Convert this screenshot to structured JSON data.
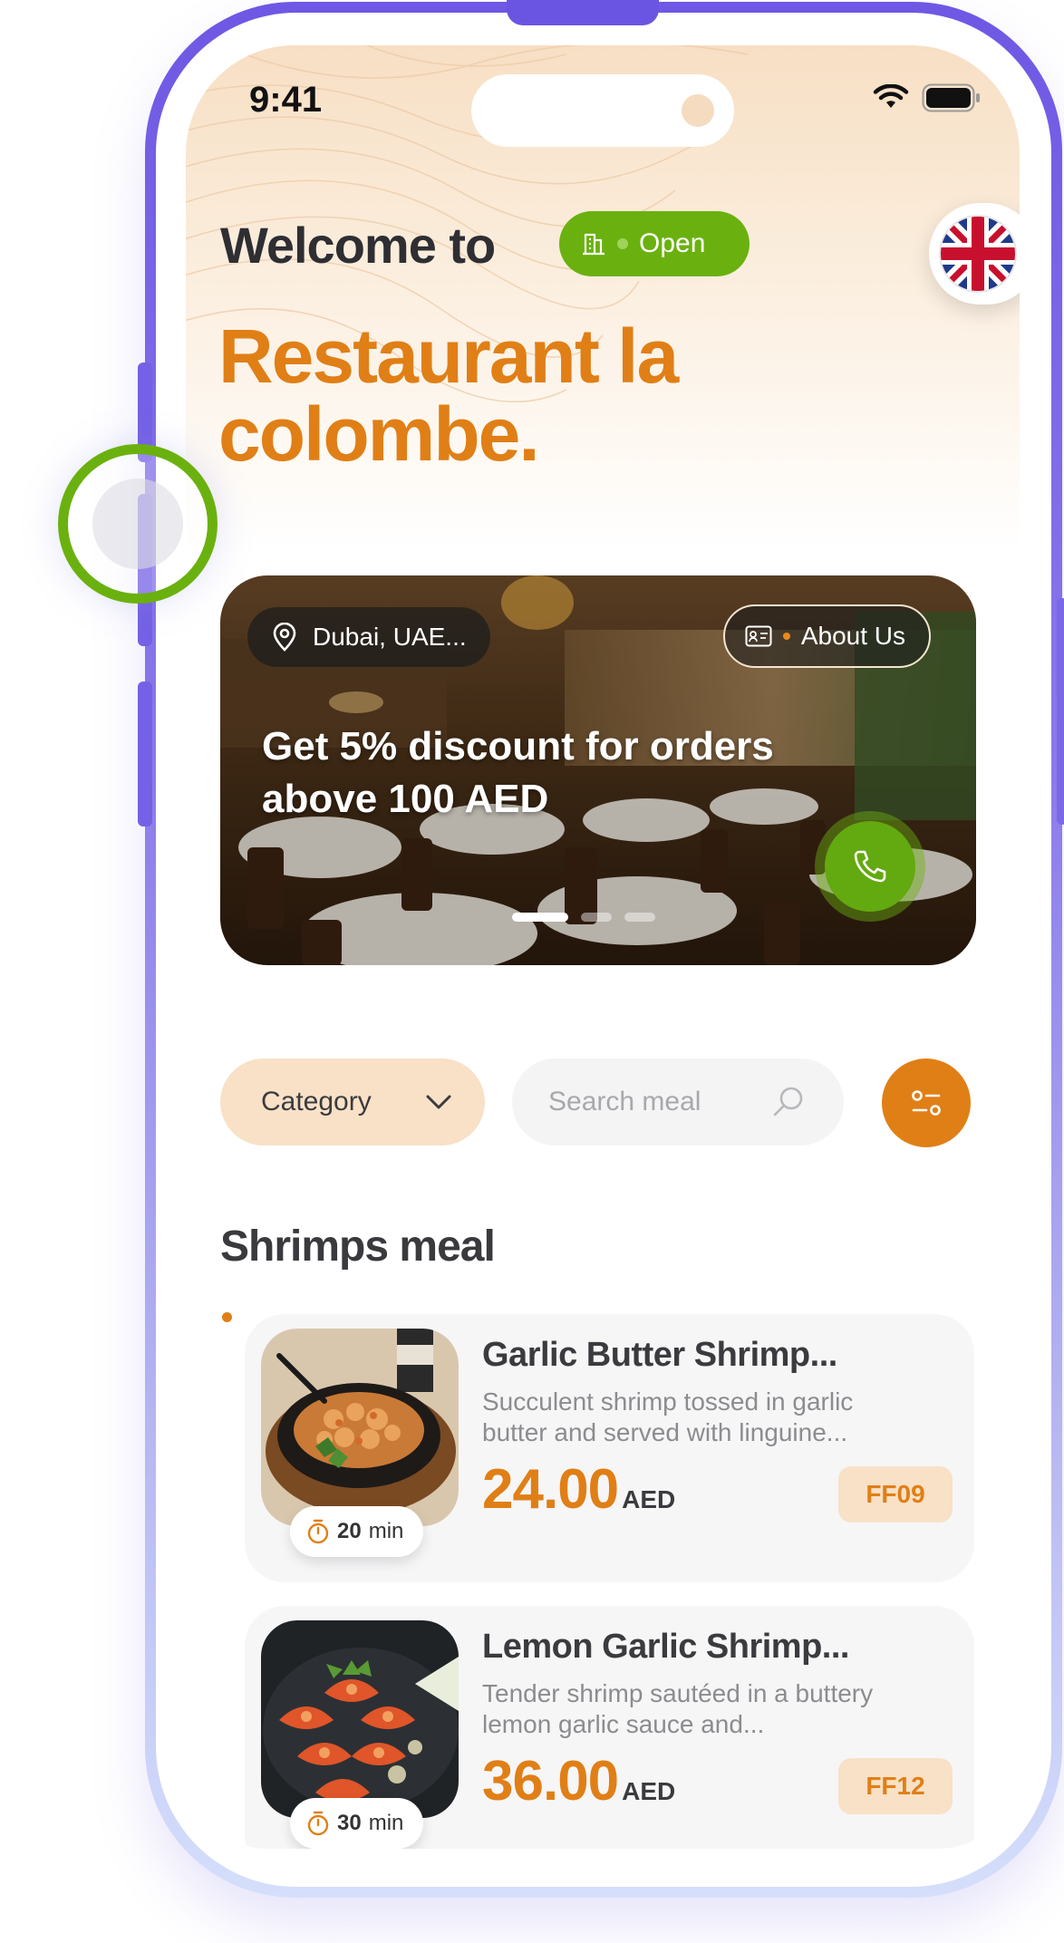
{
  "status_bar": {
    "time": "9:41"
  },
  "header": {
    "welcome": "Welcome to",
    "open_status": "Open",
    "restaurant_name": "Restaurant la colombe."
  },
  "hero": {
    "location": "Dubai, UAE...",
    "about": "About Us",
    "promo": "Get 5% discount for orders above 100 AED",
    "slides_total": 3,
    "active_slide": 1
  },
  "filters": {
    "category_label": "Category",
    "search_placeholder": "Search meal"
  },
  "section": {
    "title": "Shrimps meal"
  },
  "meals": [
    {
      "name": "Garlic Butter Shrimp...",
      "description": "Succulent shrimp tossed in garlic butter and served with linguine...",
      "price": "24.00",
      "currency": "AED",
      "code": "FF09",
      "time_value": "20",
      "time_unit": "min"
    },
    {
      "name": "Lemon Garlic Shrimp...",
      "description": "Tender shrimp sautéed in a buttery lemon garlic sauce and...",
      "price": "36.00",
      "currency": "AED",
      "code": "FF12",
      "time_value": "30",
      "time_unit": "min"
    }
  ],
  "colors": {
    "accent": "#e07f16",
    "open_green": "#6ab10f",
    "frame_purple": "#6e58e4",
    "badge_bg": "#f8e1c7"
  },
  "icons": [
    "wifi-icon",
    "battery-icon",
    "building-icon",
    "uk-flag-icon",
    "location-pin-icon",
    "id-card-icon",
    "phone-icon",
    "chevron-down-icon",
    "search-icon",
    "filter-icon",
    "timer-icon"
  ]
}
